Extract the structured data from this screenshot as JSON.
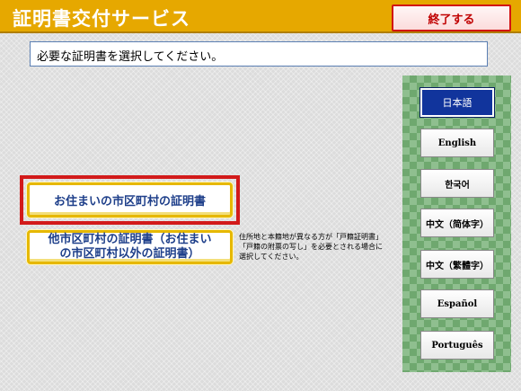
{
  "header": {
    "title": "証明書交付サービス",
    "end_button_label": "終了する"
  },
  "instruction": "必要な証明書を選択してください。",
  "certificates": {
    "residence_label": "お住まいの市区町村の証明書",
    "other_label": "他市区町村の証明書（お住まい\nの市区町村以外の証明書）",
    "other_note": "住所地と本籍地が異なる方が「戸籍証明書」「戸籍の附票の写し」を必要とされる場合に選択してください。"
  },
  "languages": [
    {
      "label": "日本語",
      "selected": true
    },
    {
      "label": "English",
      "selected": false
    },
    {
      "label": "한국어",
      "selected": false
    },
    {
      "label": "中文（简体字）",
      "selected": false
    },
    {
      "label": "中文（繁體字）",
      "selected": false
    },
    {
      "label": "Español",
      "selected": false
    },
    {
      "label": "Português",
      "selected": false
    }
  ],
  "colors": {
    "header": "#e6a800",
    "highlight": "#d21a1a",
    "selected_language": "#11349c"
  }
}
